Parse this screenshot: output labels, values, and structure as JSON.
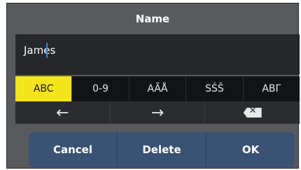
{
  "dialog": {
    "title": "Name"
  },
  "field": {
    "value": "James"
  },
  "modes": [
    {
      "label": "ABC",
      "active": true
    },
    {
      "label": "0-9",
      "active": false
    },
    {
      "label": "AÃÅ",
      "active": false
    },
    {
      "label": "SŚŠ",
      "active": false
    },
    {
      "label": "ΑΒΓ",
      "active": false
    }
  ],
  "nav": {
    "left_icon": "←",
    "right_icon": "→",
    "backspace_icon": "✕"
  },
  "actions": {
    "cancel": "Cancel",
    "delete": "Delete",
    "ok": "OK"
  },
  "colors": {
    "dialog_bg": "#585a5d",
    "field_bg": "#25272b",
    "mode_active": "#f4e51c",
    "caret": "#4d7ec6",
    "action_bar": "#3a5273"
  }
}
